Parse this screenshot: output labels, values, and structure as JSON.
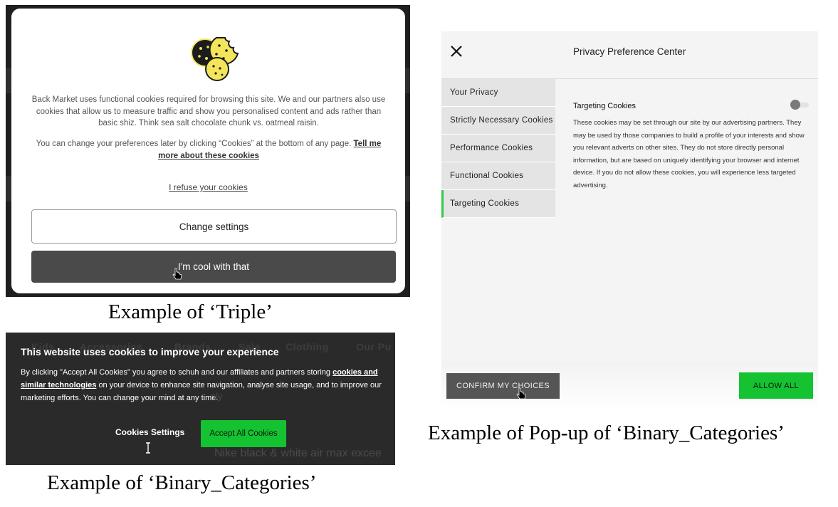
{
  "triple": {
    "body_text": "Back Market uses functional cookies required for browsing this site. We and our partners also use cookies that allow us to measure traffic and show you personalised content and ads rather than basic shiz. Think sea salt chocolate chunk vs. oatmeal raisin.",
    "prefs_text": "You can change your preferences later by clicking “Cookies” at the bottom of any page.",
    "tell_me_link": "Tell me more about these cookies",
    "refuse_link": "I refuse your cookies",
    "change_settings_label": "Change settings",
    "cool_label": "I'm cool with that",
    "icon": "cookies-icon",
    "colors": {
      "primary_button": "#4a4a4a",
      "cookie": "#f3e55b"
    }
  },
  "captions": {
    "triple": "Example of ‘Triple’",
    "binary": "Example of ‘Binary_Categories’",
    "popup": "Example of Pop-up of ‘Binary_Categories’"
  },
  "binary_banner": {
    "background_nav": [
      "Kids",
      "Accessories",
      "Brands",
      "Sale",
      "Clothing",
      "Our Pu"
    ],
    "title": "This website uses cookies to improve your experience",
    "body_before": "By clicking \"Accept All Cookies\" you agree to schuh and our affiliates and partners storing",
    "link": "cookies and similar technologies",
    "body_after": "on your device to enhance site navigation, analyse site usage, and to improve our marketing efforts. You can change your mind at any time.",
    "settings_label": "Cookies Settings",
    "accept_label": "Accept All Cookies",
    "background_product": "Nike black & white air max excee",
    "background_fragment": "nly",
    "colors": {
      "accept": "#14c232"
    }
  },
  "preference_center": {
    "title": "Privacy Preference Center",
    "close_icon": "close-icon",
    "categories": [
      "Your Privacy",
      "Strictly Necessary Cookies",
      "Performance Cookies",
      "Functional Cookies",
      "Targeting Cookies"
    ],
    "active_category": "Targeting Cookies",
    "section_heading": "Targeting Cookies",
    "section_toggle": "off",
    "section_text": "These cookies may be set through our site by our advertising partners. They may be used by those companies to build a profile of your interests and show you relevant adverts on other sites.    They do not store directly personal information, but are based on uniquely identifying your browser and internet device. If you do not allow these cookies, you will experience less targeted advertising.",
    "confirm_label": "CONFIRM MY CHOICES",
    "allow_label": "ALLOW ALL",
    "colors": {
      "active_marker": "#2ecc40",
      "allow": "#14c232"
    }
  }
}
